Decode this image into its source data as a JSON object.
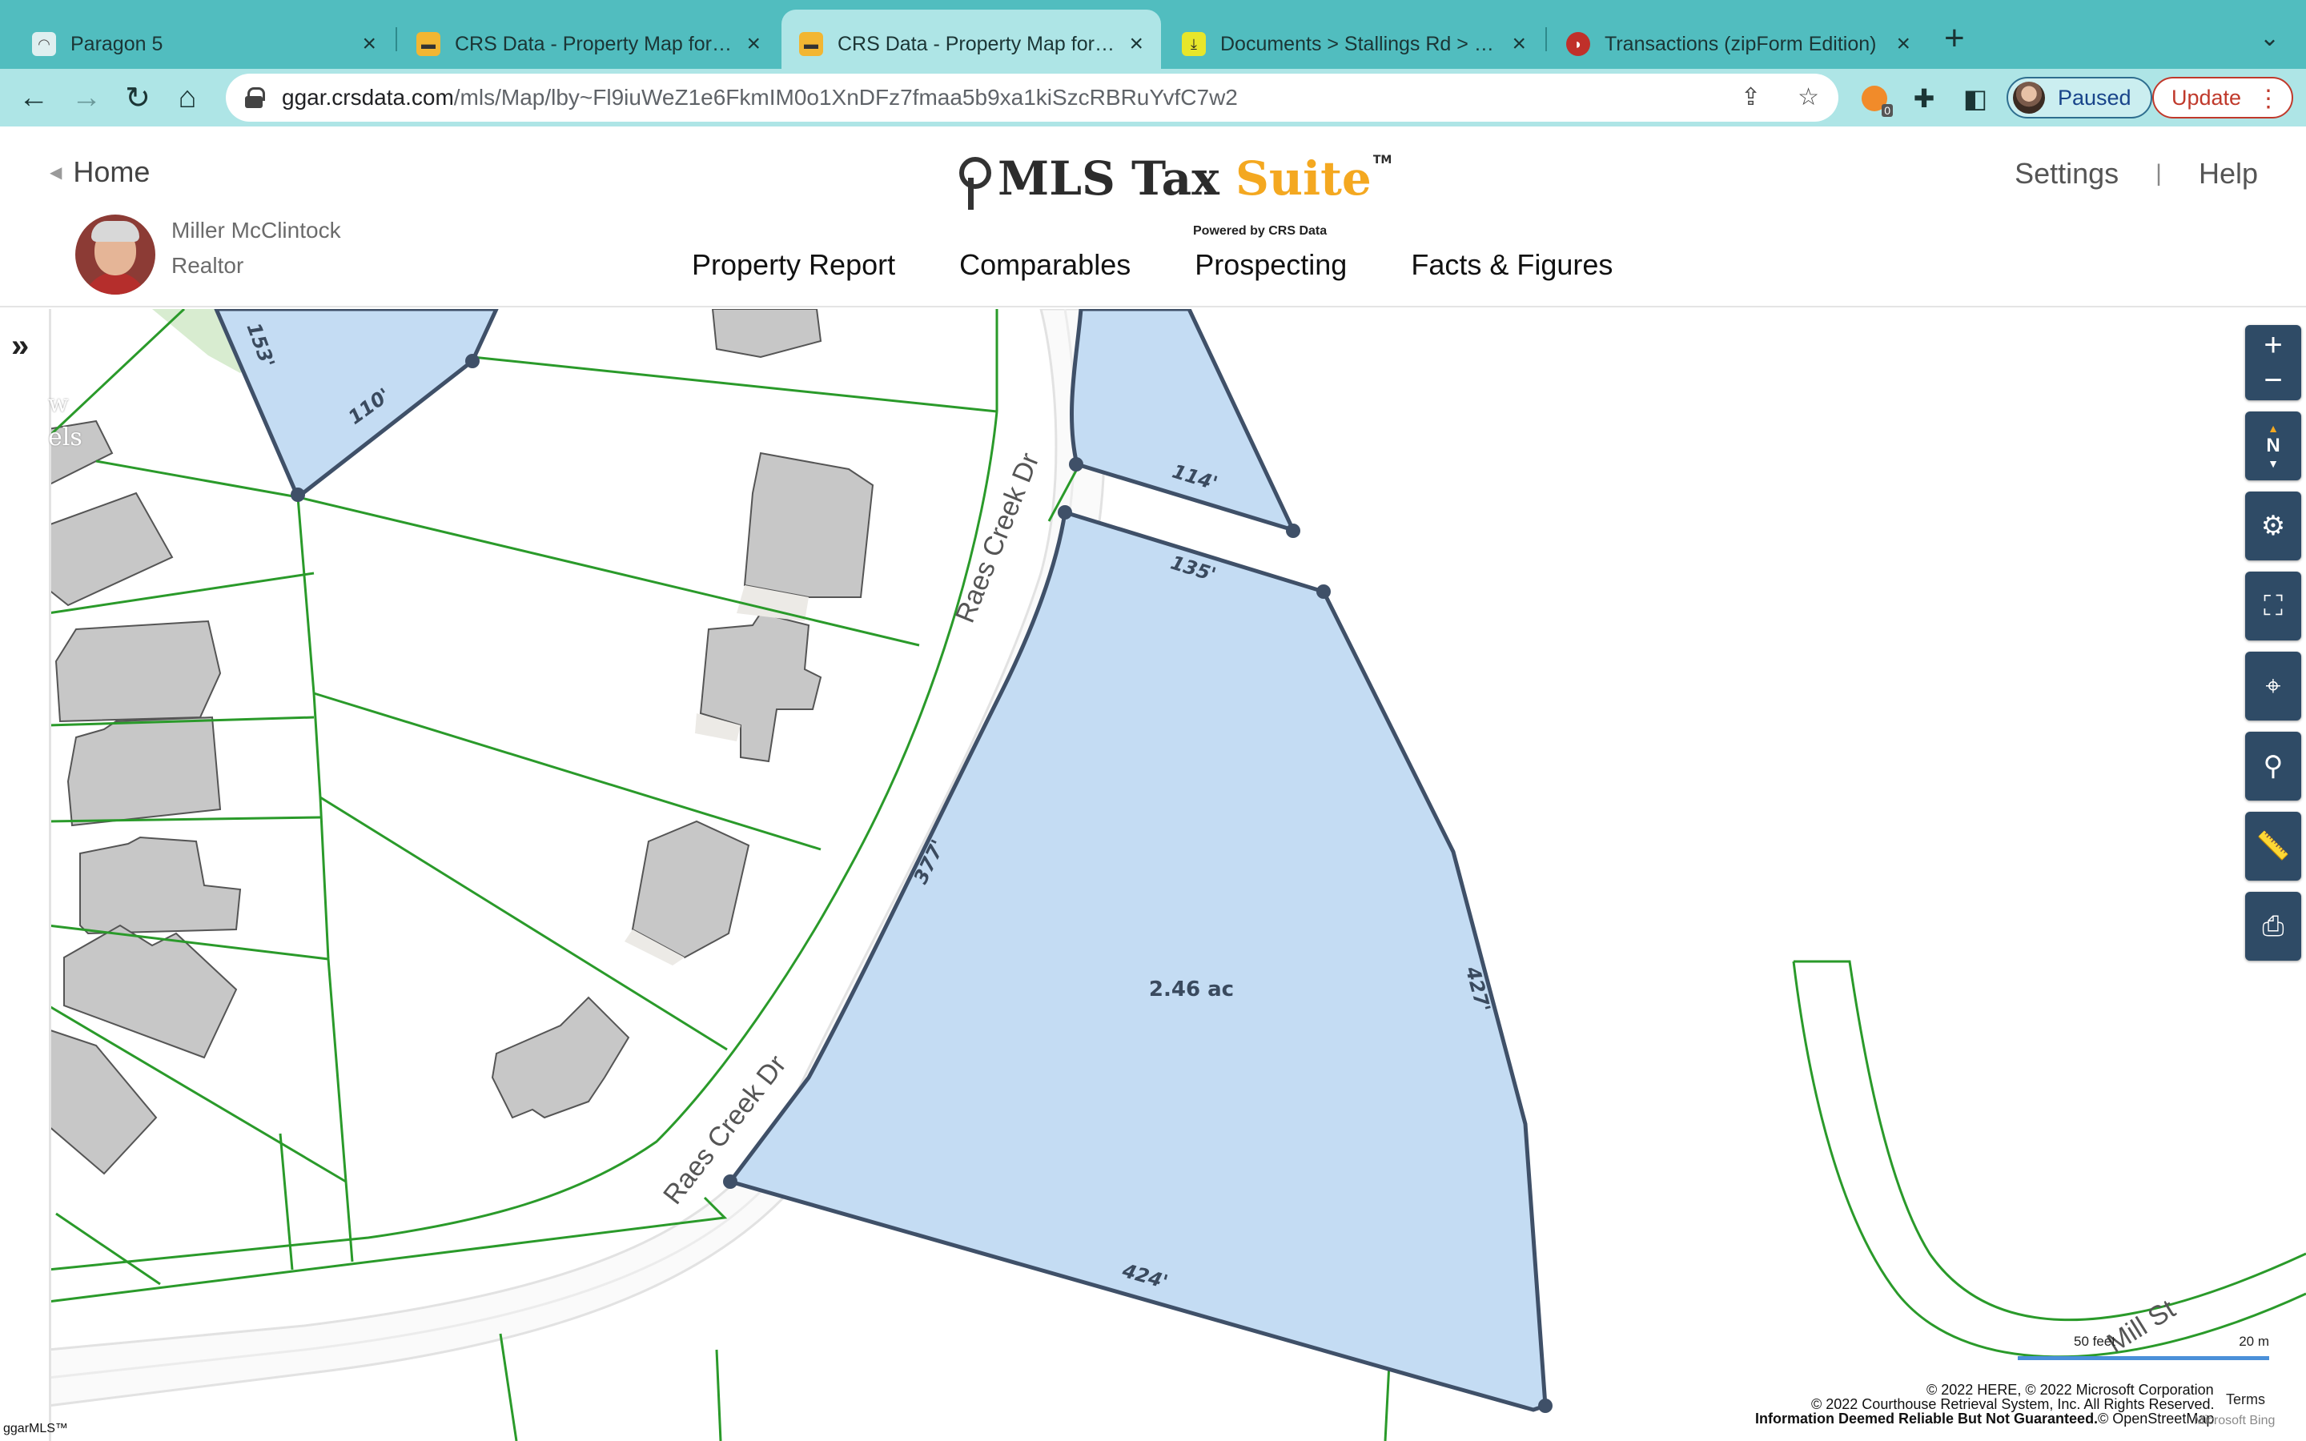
{
  "browser": {
    "tabs": [
      {
        "title": "Paragon 5",
        "active": false
      },
      {
        "title": "CRS Data - Property Map for S…",
        "active": false
      },
      {
        "title": "CRS Data - Property Map for S…",
        "active": true
      },
      {
        "title": "Documents > Stallings Rd > Do…",
        "active": false
      },
      {
        "title": "Transactions (zipForm Edition)",
        "active": false
      }
    ],
    "url_host": "ggar.crsdata.com",
    "url_path": "/mls/Map/lby~Fl9iuWeZ1e6FkmIM0o1XnDFz7fmaa5b9xa1kiSzcRBRuYvfC7w2",
    "extension_badge": "0",
    "profile_label": "Paused",
    "update_label": "Update"
  },
  "header": {
    "home_label": "Home",
    "logo_text_a": "MLS Tax ",
    "logo_text_b": "Suite",
    "logo_tm": "TM",
    "logo_powered": "Powered by CRS Data",
    "settings_label": "Settings",
    "divider": "|",
    "help_label": "Help",
    "agent_name": "Miller McClintock",
    "agent_title": "Realtor",
    "nav": [
      "Property Report",
      "Comparables",
      "Prospecting",
      "Facts & Figures"
    ]
  },
  "map": {
    "side_peek": [
      "w",
      "els"
    ],
    "parcel_area": "2.46 ac",
    "dimensions": {
      "main_top": "135'",
      "main_left": "377'",
      "main_right": "427'",
      "main_bottom": "424'",
      "north_lot": "114'",
      "nw_lot_a": "153'",
      "nw_lot_b": "110'"
    },
    "streets": [
      "Raes Creek Dr",
      "Raes Creek Dr",
      "Mill St"
    ],
    "scale_feet": "50 feet",
    "scale_meters": "20 m",
    "attrib_1": "© 2022 HERE, © 2022 Microsoft Corporation",
    "attrib_2": "© 2022 Courthouse Retrieval System, Inc. All Rights Reserved.",
    "attrib_3": "Information Deemed Reliable But Not Guaranteed.",
    "attrib_4": "© OpenStreetMap",
    "terms_label": "Terms",
    "bing_label": "Microsoft Bing",
    "mls_mark": "ggarMLS™",
    "colors": {
      "parcel_fill": "#c4dcf3",
      "parcel_stroke": "#3f5068",
      "lot_line": "#2a9a2a",
      "building": "#c7c7c7",
      "control_bg": "#2f4b66"
    }
  }
}
